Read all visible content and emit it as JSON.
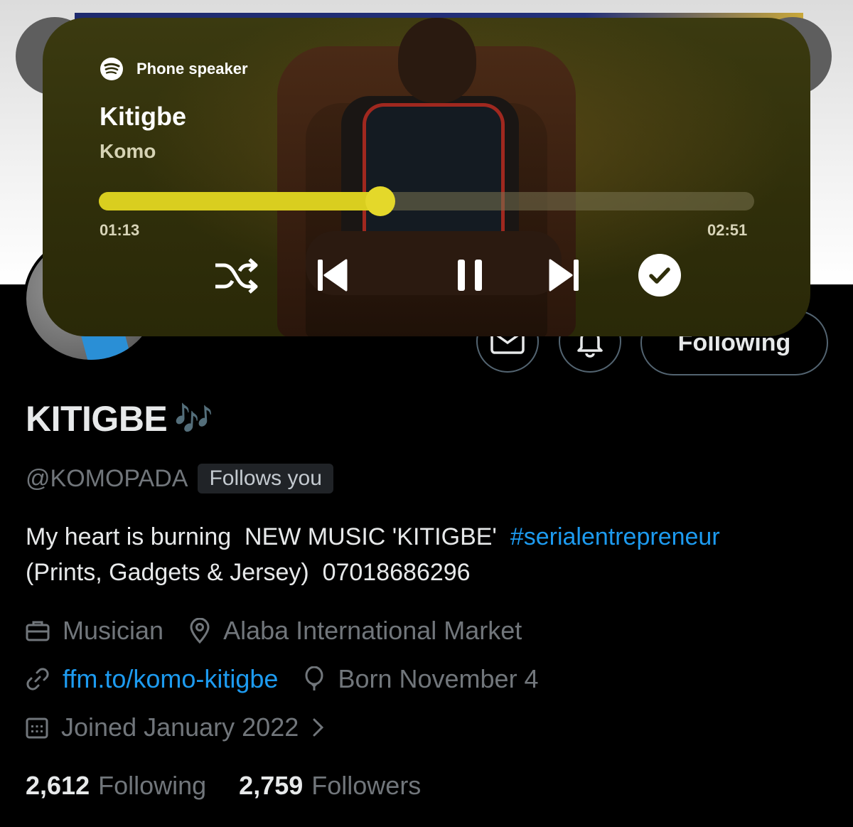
{
  "player": {
    "output_device": "Phone speaker",
    "output_icon": "spotify-icon",
    "title": "Kitigbe",
    "artist": "Komo",
    "elapsed": "01:13",
    "duration": "02:51",
    "progress_fraction": 0.43,
    "accent_color": "#d9ce1f",
    "controls": [
      "shuffle-icon",
      "previous-icon",
      "pause-icon",
      "next-icon",
      "check-circle-icon"
    ]
  },
  "profile": {
    "name": "KITIGBE",
    "name_emoji": "🎶",
    "handle": "@KOMOPADA",
    "follows_badge": "Follows you",
    "bio_text": "My heart is burning  NEW MUSIC 'KITIGBE'  ",
    "bio_hashtag": "#serialentrepreneur",
    "bio_line2": "(Prints, Gadgets & Jersey)  07018686296",
    "following_button": "Following",
    "profession": "Musician",
    "location": "Alaba International Market",
    "website": "ffm.to/komo-kitigbe",
    "birthday": "Born November 4",
    "joined": "Joined January 2022",
    "following_count": "2,612",
    "following_label": "Following",
    "followers_count": "2,759",
    "followers_label": "Followers",
    "link_color": "#1d9bf0"
  }
}
